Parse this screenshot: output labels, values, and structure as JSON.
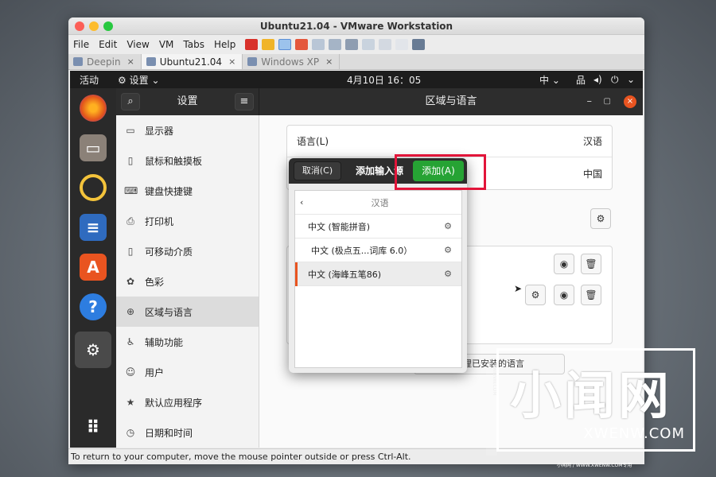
{
  "window": {
    "title": "Ubuntu21.04 - VMware Workstation",
    "traffic_colors": [
      "#fc5f57",
      "#fdbc2e",
      "#28c840"
    ]
  },
  "menubar": {
    "items": [
      "File",
      "Edit",
      "View",
      "VM",
      "Tabs",
      "Help"
    ]
  },
  "tabs": [
    {
      "label": "Deepin",
      "close": "×"
    },
    {
      "label": "Ubuntu21.04",
      "close": "×"
    },
    {
      "label": "Windows XP",
      "close": "×"
    }
  ],
  "ubuntu_topbar": {
    "activities": "活动",
    "app_menu": "设置",
    "clock": "4月10日  16：05",
    "input_method": "中"
  },
  "settings": {
    "sidebar_title": "设置",
    "panel_title": "区域与语言",
    "sidebar_items": [
      {
        "label": "显示器",
        "icon": "monitor-icon"
      },
      {
        "label": "鼠标和触摸板",
        "icon": "mouse-icon"
      },
      {
        "label": "键盘快捷键",
        "icon": "keyboard-icon"
      },
      {
        "label": "打印机",
        "icon": "printer-icon"
      },
      {
        "label": "可移动介质",
        "icon": "media-icon"
      },
      {
        "label": "色彩",
        "icon": "color-icon"
      },
      {
        "label": "区域与语言",
        "icon": "globe-icon"
      },
      {
        "label": "辅助功能",
        "icon": "accessibility-icon"
      },
      {
        "label": "用户",
        "icon": "users-icon"
      },
      {
        "label": "默认应用程序",
        "icon": "star-icon"
      },
      {
        "label": "日期和时间",
        "icon": "clock-icon"
      }
    ],
    "language_label": "语言(L)",
    "language_value": "汉语",
    "formats_value": "中国",
    "manage_languages": "管理已安装的语言"
  },
  "dialog": {
    "cancel_label": "取消(C)",
    "title": "添加输入源",
    "add_label": "添加(A)",
    "list_header": "汉语",
    "items": [
      "中文 (智能拼音)",
      "中文 (极点五...词库 6.0）",
      "中文 (海峰五笔86)"
    ]
  },
  "statusbar": {
    "text": "To return to your computer, move the mouse pointer outside or press Ctrl-Alt."
  },
  "watermark": {
    "big": "小闻网",
    "small": "XWENW.COM",
    "footer": "小闻网 / WWW.XWENW.COM专用",
    "side": "XWENW.COM"
  },
  "colors": {
    "accent": "#e95420",
    "add_button": "#26a334",
    "highlight": "#e2153a"
  }
}
